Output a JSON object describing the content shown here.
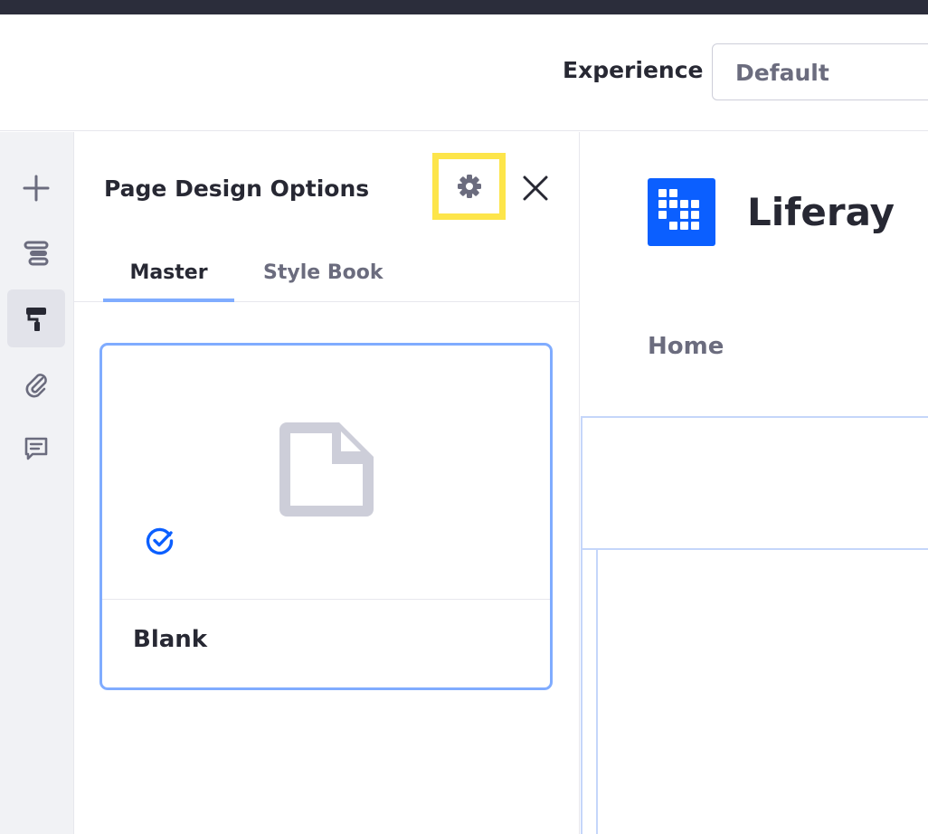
{
  "toolbar": {
    "experience_label": "Experience",
    "experience_value": "Default"
  },
  "sidebar": {
    "items": [
      {
        "icon": "plus-icon",
        "active": false
      },
      {
        "icon": "page-structure-icon",
        "active": false
      },
      {
        "icon": "paint-roller-icon",
        "active": true
      },
      {
        "icon": "paperclip-icon",
        "active": false
      },
      {
        "icon": "comments-icon",
        "active": false
      }
    ]
  },
  "panel": {
    "title": "Page Design Options",
    "tabs": [
      {
        "label": "Master",
        "active": true
      },
      {
        "label": "Style Book",
        "active": false
      }
    ],
    "card": {
      "title": "Blank",
      "selected": true
    }
  },
  "canvas": {
    "site_name": "Liferay",
    "nav_items": [
      "Home"
    ]
  },
  "colors": {
    "highlight": "#fde54a",
    "accent": "#80acff",
    "brand": "#0b5fff",
    "check": "#0b5fff"
  }
}
